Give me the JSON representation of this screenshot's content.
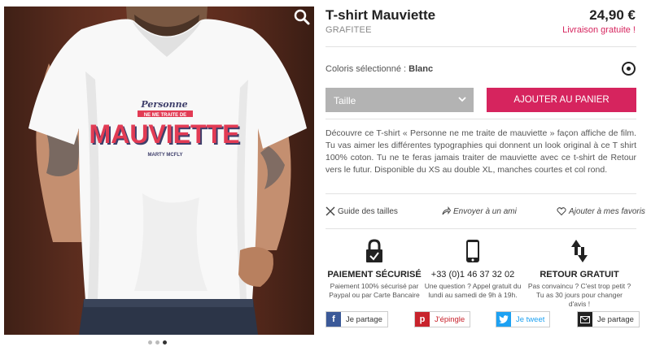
{
  "product": {
    "title": "T-shirt Mauviette",
    "brand": "GRAFITEE",
    "price": "24,90 €",
    "shipping": "Livraison gratuite !",
    "colour_label": "Coloris sélectionné :",
    "colour_value": "Blanc",
    "size_placeholder": "Taille",
    "add_to_cart": "AJOUTER AU PANIER",
    "description": "Découvre ce T-shirt « Personne ne me traite de mauviette » façon affiche de film. Tu vas aimer les différentes typographies qui donnent un look original à ce T shirt 100% coton. Tu ne te feras jamais traiter de mauviette avec ce t-shirt de Retour vers le futur. Disponible du XS au double XL, manches courtes et col rond."
  },
  "print": {
    "line1": "Personne",
    "line2": "NE ME TRAITE DE",
    "line3": "MAUVIETTE",
    "line4": "MARTY MCFLY"
  },
  "gallery": {
    "slides": 3,
    "active_index": 2
  },
  "utilities": {
    "size_guide": "Guide des tailles",
    "send_friend": "Envoyer à un ami",
    "favorites": "Ajouter à mes favoris"
  },
  "assurances": [
    {
      "head": "PAIEMENT SÉCURISÉ",
      "sub": [
        "Paiement 100% sécurisé par",
        "Paypal ou par Carte Bancaire"
      ],
      "icon": "lock-icon"
    },
    {
      "head": "+33 (0)1 46 37 32 02",
      "sub": [
        "Une question ? Appel gratuit du",
        "lundi au samedi de 9h à 19h."
      ],
      "icon": "phone-icon"
    },
    {
      "head": "RETOUR GRATUIT",
      "sub": [
        "Pas convaincu ? C'est trop petit ?",
        "Tu as 30 jours pour changer d'avis !"
      ],
      "icon": "swap-arrows-icon"
    }
  ],
  "share": {
    "facebook": "Je partage",
    "pinterest": "J'épingle",
    "twitter": "Je tweet",
    "email": "Je partage"
  },
  "colors": {
    "accent": "#d6245e",
    "select_grey": "#b3b3b3",
    "facebook": "#3b5998",
    "pinterest": "#c8232c",
    "twitter": "#1da1f2",
    "email": "#222222"
  }
}
